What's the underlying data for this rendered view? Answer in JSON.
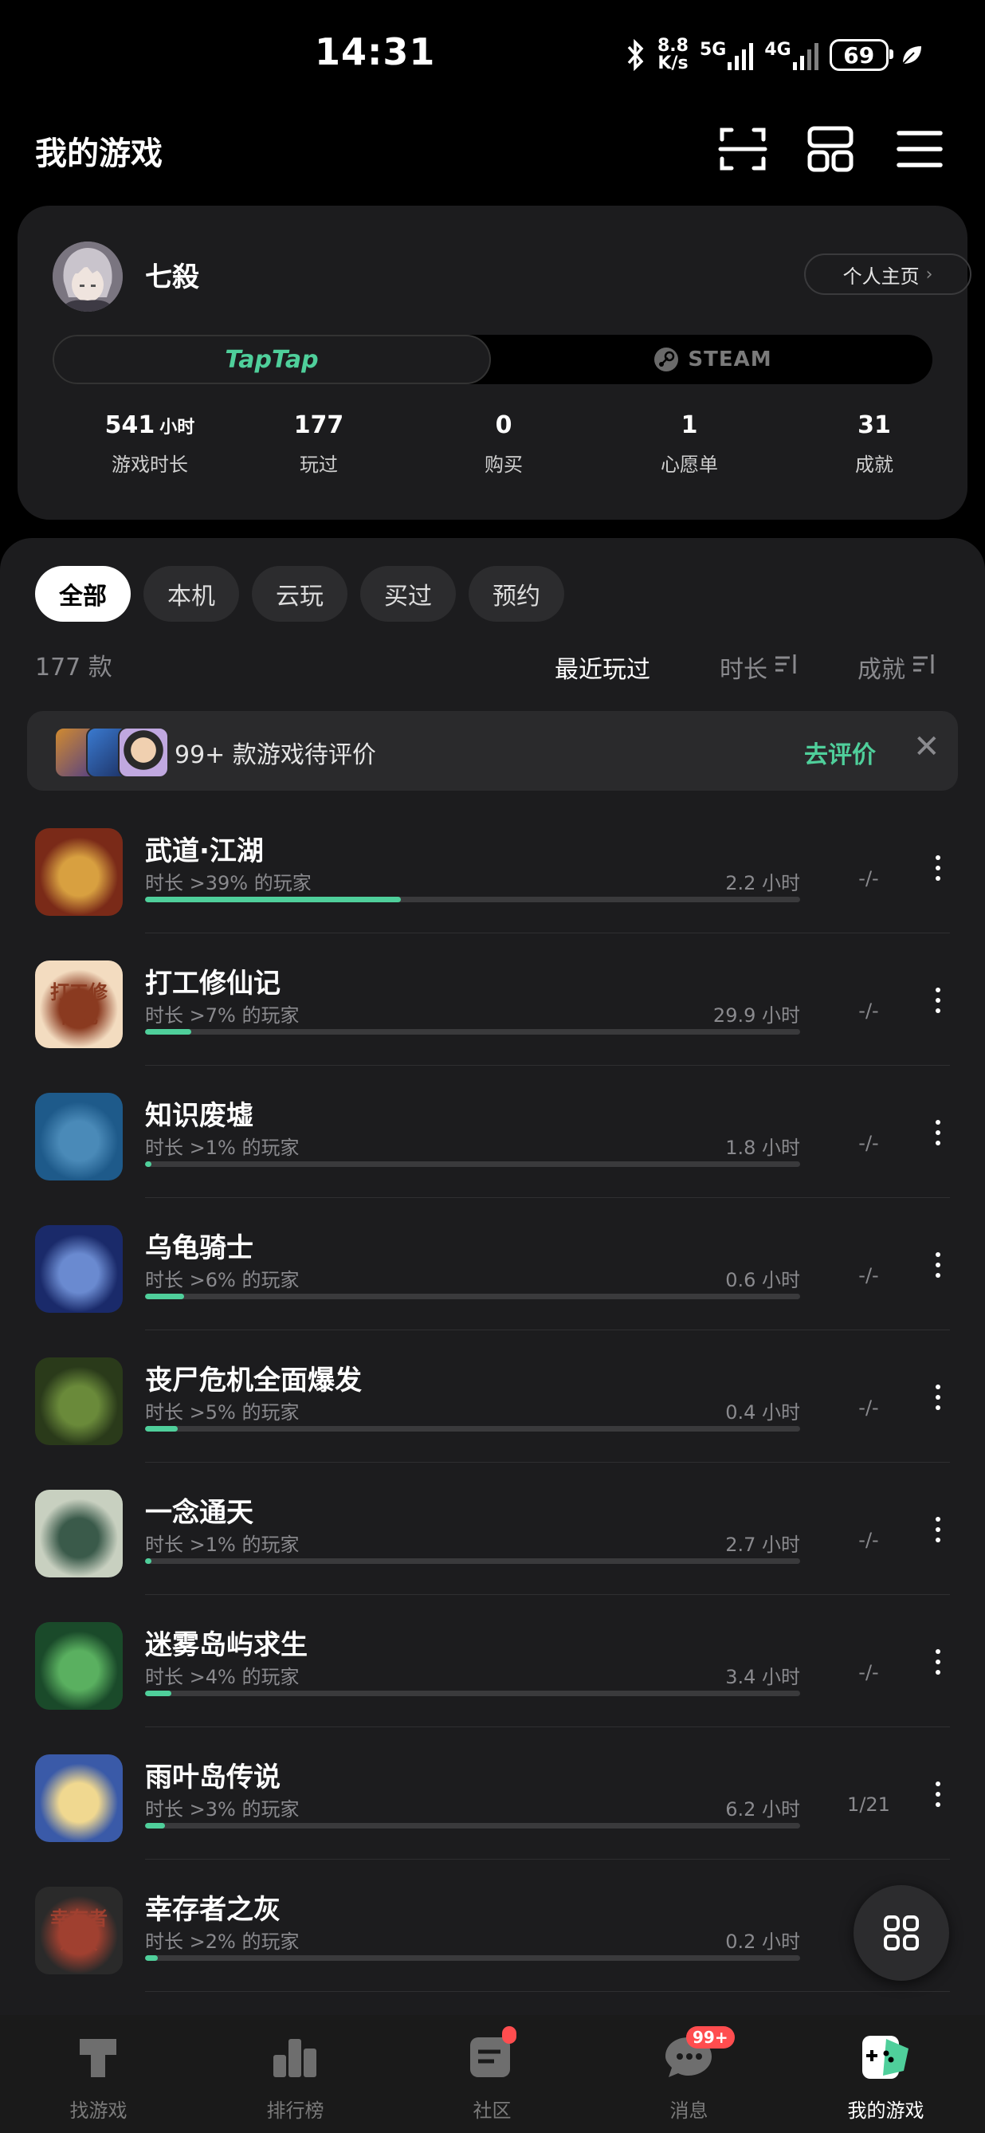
{
  "status_bar": {
    "time": "14:31",
    "net_speed_top": "8.8",
    "net_speed_bottom": "K/s",
    "net1": "5G",
    "net2": "4G",
    "battery": "69"
  },
  "header": {
    "title": "我的游戏",
    "icons": [
      "scan-icon",
      "grid-layout-icon",
      "menu-icon"
    ]
  },
  "profile": {
    "username": "七殺",
    "home_button": "个人主页",
    "platforms": [
      "TapTap",
      "STEAM"
    ],
    "stats": [
      {
        "value": "541",
        "unit": "小时",
        "label": "游戏时长"
      },
      {
        "value": "177",
        "unit": "",
        "label": "玩过"
      },
      {
        "value": "0",
        "unit": "",
        "label": "购买"
      },
      {
        "value": "1",
        "unit": "",
        "label": "心愿单"
      },
      {
        "value": "31",
        "unit": "",
        "label": "成就"
      }
    ]
  },
  "filters": {
    "chips": [
      "全部",
      "本机",
      "云玩",
      "买过",
      "预约"
    ],
    "active": "全部"
  },
  "sort": {
    "count": "177 款",
    "options": [
      "最近玩过",
      "时长",
      "成就"
    ],
    "active": "最近玩过"
  },
  "review_banner": {
    "text": "99+ 款游戏待评价",
    "action": "去评价"
  },
  "games": [
    {
      "name": "武道·江湖",
      "sub": "时长 >39% 的玩家",
      "hours": "2.2 小时",
      "achievements": "-/-",
      "progress": 0.39,
      "icon_colors": [
        "#7a2a18",
        "#d8a040"
      ]
    },
    {
      "name": "打工修仙记",
      "sub": "时长 >7% 的玩家",
      "hours": "29.9 小时",
      "achievements": "-/-",
      "progress": 0.07,
      "icon_colors": [
        "#f3dcc0",
        "#8a3a20"
      ],
      "icon_text": "打工修仙记"
    },
    {
      "name": "知识废墟",
      "sub": "时长 >1% 的玩家",
      "hours": "1.8 小时",
      "achievements": "-/-",
      "progress": 0.01,
      "icon_colors": [
        "#1e5a8a",
        "#4a8ab8"
      ]
    },
    {
      "name": "乌龟骑士",
      "sub": "时长 >6% 的玩家",
      "hours": "0.6 小时",
      "achievements": "-/-",
      "progress": 0.06,
      "icon_colors": [
        "#1a2a6a",
        "#6a8ad0"
      ]
    },
    {
      "name": "丧尸危机全面爆发",
      "sub": "时长 >5% 的玩家",
      "hours": "0.4 小时",
      "achievements": "-/-",
      "progress": 0.05,
      "icon_colors": [
        "#2a3a1a",
        "#6a8a3a"
      ]
    },
    {
      "name": "一念通天",
      "sub": "时长 >1% 的玩家",
      "hours": "2.7 小时",
      "achievements": "-/-",
      "progress": 0.01,
      "icon_colors": [
        "#c8d0c0",
        "#3a5a4a"
      ]
    },
    {
      "name": "迷雾岛屿求生",
      "sub": "时长 >4% 的玩家",
      "hours": "3.4 小时",
      "achievements": "-/-",
      "progress": 0.04,
      "icon_colors": [
        "#1a4a2a",
        "#5ab060"
      ]
    },
    {
      "name": "雨叶岛传说",
      "sub": "时长 >3% 的玩家",
      "hours": "6.2 小时",
      "achievements": "1/21",
      "progress": 0.03,
      "icon_colors": [
        "#3a5aa8",
        "#f0d890"
      ]
    },
    {
      "name": "幸存者之灰",
      "sub": "时长 >2% 的玩家",
      "hours": "0.2 小时",
      "achievements": "-/-",
      "progress": 0.02,
      "icon_colors": [
        "#2a2a2a",
        "#a04030"
      ],
      "icon_text": "幸存者之灰"
    }
  ],
  "bottom_nav": [
    {
      "label": "找游戏",
      "icon": "tap-logo-icon"
    },
    {
      "label": "排行榜",
      "icon": "ranking-icon"
    },
    {
      "label": "社区",
      "icon": "community-icon"
    },
    {
      "label": "消息",
      "icon": "chat-icon",
      "badge": "99+"
    },
    {
      "label": "我的游戏",
      "icon": "gamepad-icon"
    }
  ],
  "colors": {
    "accent": "#4fcf9b",
    "background": "#000000",
    "panel": "#1c1c1e",
    "badge": "#ff4d4f"
  }
}
